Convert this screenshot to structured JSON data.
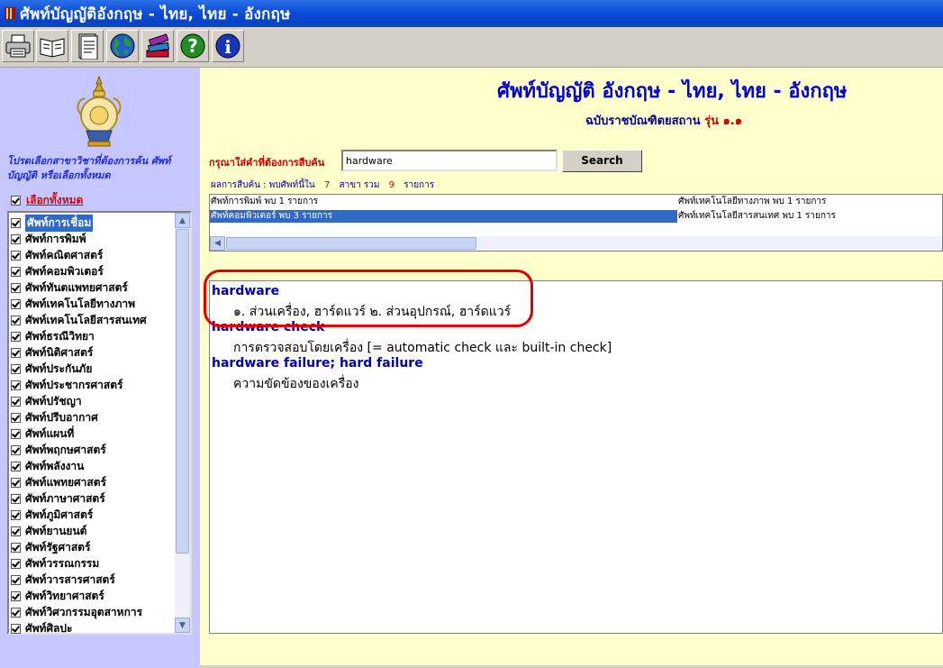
{
  "window": {
    "title": "ศัพท์บัญญัติอังกฤษ - ไทย, ไทย - อังกฤษ"
  },
  "toolbar": {
    "buttons": [
      {
        "icon": "printer-icon"
      },
      {
        "icon": "open-book-icon"
      },
      {
        "icon": "document-icon"
      },
      {
        "icon": "globe-icon"
      },
      {
        "icon": "books-stack-icon"
      },
      {
        "icon": "help-icon"
      },
      {
        "icon": "info-icon"
      }
    ]
  },
  "sidebar": {
    "emblem_icon": "royal-emblem-icon",
    "hint": "โปรดเลือกสาขาวิชาที่ต้องการค้น ศัพท์บัญญัติ หรือเลือกทั้งหมด",
    "select_all_label": "เลือกทั้งหมด",
    "categories": [
      "ศัพท์การเชื่อม",
      "ศัพท์การพิมพ์",
      "ศัพท์คณิตศาสตร์",
      "ศัพท์คอมพิวเตอร์",
      "ศัพท์ทันตแพทยศาสตร์",
      "ศัพท์เทคโนโลยีทางภาพ",
      "ศัพท์เทคโนโลยีสารสนเทศ",
      "ศัพท์ธรณีวิทยา",
      "ศัพท์นิติศาสตร์",
      "ศัพท์ประกันภัย",
      "ศัพท์ประชากรศาสตร์",
      "ศัพท์ปรัชญา",
      "ศัพท์ปรีบอากาศ",
      "ศัพท์แผนที่",
      "ศัพท์พฤกษศาสตร์",
      "ศัพท์พลังงาน",
      "ศัพท์แพทยศาสตร์",
      "ศัพท์ภาษาศาสตร์",
      "ศัพท์ภูมิศาสตร์",
      "ศัพท์ยานยนต์",
      "ศัพท์รัฐศาสตร์",
      "ศัพท์วรรณกรรม",
      "ศัพท์วารสารศาสตร์",
      "ศัพท์วิทยาศาสตร์",
      "ศัพท์วิศวกรรมอุตสาหการ",
      "ศัพท์ศิลปะ"
    ],
    "selected_index": 0
  },
  "header": {
    "title": "ศัพท์บัญญัติ อังกฤษ - ไทย, ไทย - อังกฤษ",
    "subtitle": "ฉบับราชบัณฑิตยสถาน",
    "version": "รุ่น ๑.๑"
  },
  "search": {
    "prompt": "กรุณาใส่คำที่ต้องการสืบค้น",
    "value": "hardware",
    "button_label": "Search"
  },
  "results": {
    "prefix": "ผลการสืบค้น : พบศัพท์นี้ใน",
    "count": "7",
    "mid": "สาขา รวม",
    "total": "9",
    "suffix": "รายการ",
    "rows": [
      {
        "left": "ศัพท์การพิมพ์ พบ 1 รายการ",
        "right": "ศัพท์เทคโนโลยีทางภาพ พบ 1 รายการ"
      },
      {
        "left": "ศัพท์คอมพิวเตอร์ พบ 3 รายการ",
        "right": "ศัพท์เทคโนโลยีสารสนเทศ พบ 1 รายการ"
      }
    ]
  },
  "definitions": [
    {
      "term": "hardware",
      "text": "๑. ส่วนเครื่อง, ฮาร์ดแวร์   ๒. ส่วนอุปกรณ์, ฮาร์ดแวร์"
    },
    {
      "term": "hardware check",
      "text": "การตรวจสอบโดยเครื่อง [= automatic check และ built-in check]"
    },
    {
      "term": "hardware failure; hard failure",
      "text": "ความขัดข้องของเครื่อง"
    }
  ],
  "colors": {
    "accent_red": "#e00000",
    "title_blue": "#0000cc",
    "selection": "#316ac5"
  }
}
